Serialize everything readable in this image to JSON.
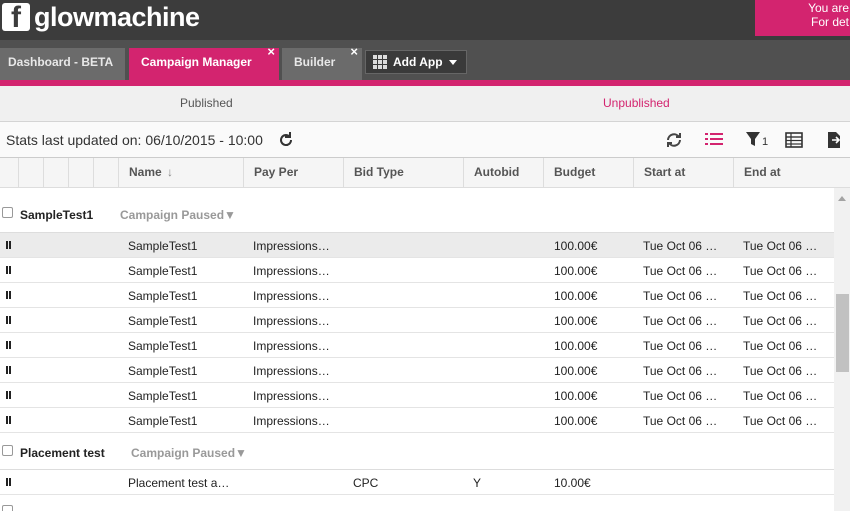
{
  "app": {
    "logo_letter": "f",
    "logo_text": "glowmachine"
  },
  "notice": {
    "line1": "You are",
    "line2": "For det"
  },
  "tabs": [
    {
      "label": "Dashboard - BETA",
      "active": false,
      "closable": false
    },
    {
      "label": "Campaign Manager",
      "active": true,
      "closable": true
    },
    {
      "label": "Builder",
      "active": false,
      "closable": true
    }
  ],
  "tab_close_glyph": "×",
  "add_app": {
    "label": "Add App"
  },
  "subtabs": {
    "published": "Published",
    "unpublished": "Unpublished"
  },
  "stats": {
    "label": "Stats last updated on: 06/10/2015 - 10:00"
  },
  "toolbar": {
    "filter_count": "1"
  },
  "columns": {
    "name": "Name",
    "sort_arrow": "↓",
    "pay_per": "Pay Per",
    "bid_type": "Bid Type",
    "autobid": "Autobid",
    "budget": "Budget",
    "start_at": "Start at",
    "end_at": "End at"
  },
  "groups": [
    {
      "name": "SampleTest1",
      "status": "Campaign Paused",
      "status_arrow": "▼",
      "rows": [
        {
          "name": "SampleTest1",
          "pay_per": "Impressions…",
          "bid_type": "",
          "autobid": "",
          "budget": "100.00€",
          "start_at": "Tue Oct 06 …",
          "end_at": "Tue Oct 06 …"
        },
        {
          "name": "SampleTest1",
          "pay_per": "Impressions…",
          "bid_type": "",
          "autobid": "",
          "budget": "100.00€",
          "start_at": "Tue Oct 06 …",
          "end_at": "Tue Oct 06 …"
        },
        {
          "name": "SampleTest1",
          "pay_per": "Impressions…",
          "bid_type": "",
          "autobid": "",
          "budget": "100.00€",
          "start_at": "Tue Oct 06 …",
          "end_at": "Tue Oct 06 …"
        },
        {
          "name": "SampleTest1",
          "pay_per": "Impressions…",
          "bid_type": "",
          "autobid": "",
          "budget": "100.00€",
          "start_at": "Tue Oct 06 …",
          "end_at": "Tue Oct 06 …"
        },
        {
          "name": "SampleTest1",
          "pay_per": "Impressions…",
          "bid_type": "",
          "autobid": "",
          "budget": "100.00€",
          "start_at": "Tue Oct 06 …",
          "end_at": "Tue Oct 06 …"
        },
        {
          "name": "SampleTest1",
          "pay_per": "Impressions…",
          "bid_type": "",
          "autobid": "",
          "budget": "100.00€",
          "start_at": "Tue Oct 06 …",
          "end_at": "Tue Oct 06 …"
        },
        {
          "name": "SampleTest1",
          "pay_per": "Impressions…",
          "bid_type": "",
          "autobid": "",
          "budget": "100.00€",
          "start_at": "Tue Oct 06 …",
          "end_at": "Tue Oct 06 …"
        },
        {
          "name": "SampleTest1",
          "pay_per": "Impressions…",
          "bid_type": "",
          "autobid": "",
          "budget": "100.00€",
          "start_at": "Tue Oct 06 …",
          "end_at": "Tue Oct 06 …"
        }
      ]
    },
    {
      "name": "Placement test",
      "status": "Campaign Paused",
      "status_arrow": "▼",
      "rows": [
        {
          "name": "Placement test a…",
          "pay_per": "",
          "bid_type": "CPC",
          "autobid": "Y",
          "budget": "10.00€",
          "start_at": "",
          "end_at": ""
        }
      ]
    }
  ],
  "colors": {
    "accent": "#d3246f",
    "topbar": "#3c3c3c",
    "tabbar": "#505050"
  },
  "icons": [
    "facebook-icon",
    "close-icon",
    "grid-icon",
    "chevron-down-icon",
    "refresh-icon",
    "list-view-icon",
    "filter-icon",
    "table-view-icon",
    "export-icon",
    "sort-arrow-icon",
    "pause-icon"
  ]
}
